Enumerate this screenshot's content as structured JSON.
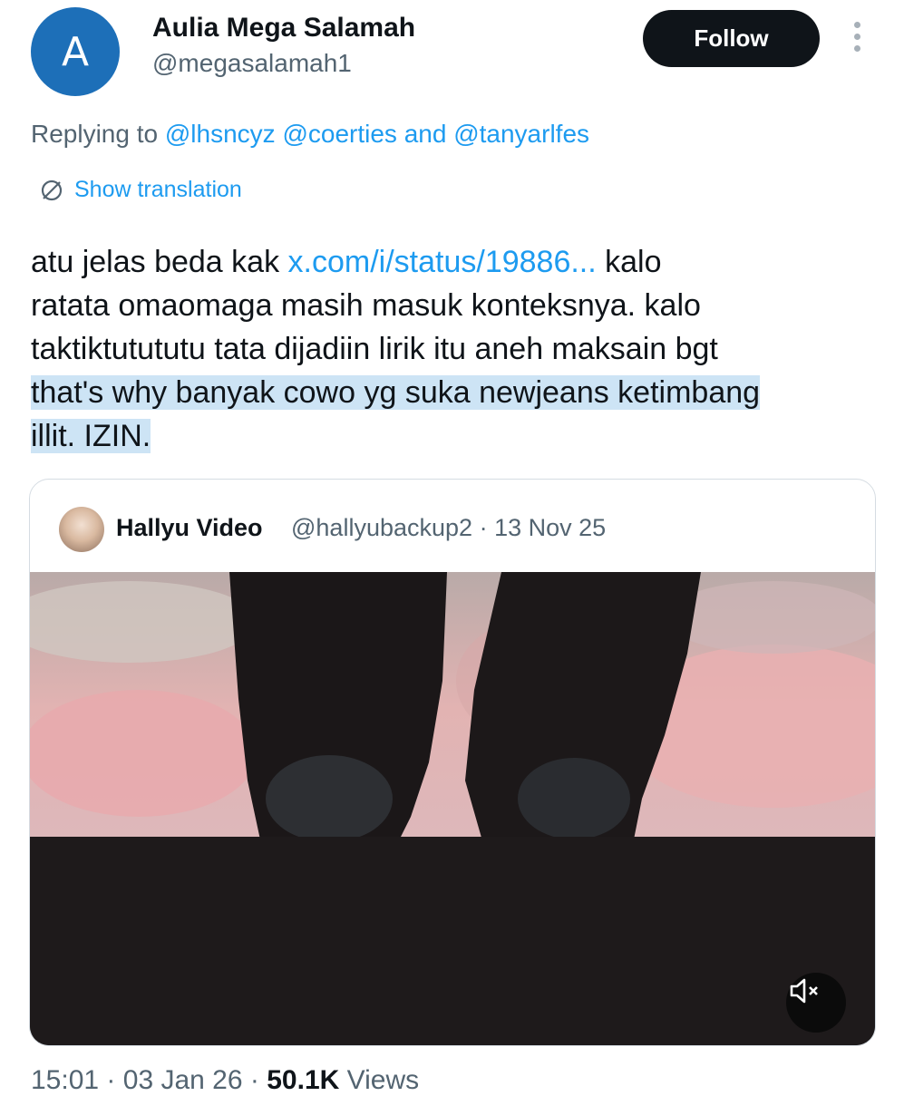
{
  "author": {
    "initial": "A",
    "display_name": "Aulia Mega Salamah",
    "handle": "@megasalamah1",
    "avatar_color": "#1d6fb8"
  },
  "follow_label": "Follow",
  "replying": {
    "prefix": "Replying to",
    "mention_1": "@lhsncyz",
    "mention_2": "@coerties",
    "conjunction": "and",
    "mention_3": "@tanyarlfes"
  },
  "show_translation": "Show translation",
  "tweet": {
    "line1_pre": "atu jelas beda kak ",
    "link": "x.com/i/status/19886...",
    "line1_post": " kalo",
    "line2": "ratata omaomaga masih masuk konteksnya. kalo",
    "line3": "taktiktutututu tata dijadiin lirik itu aneh maksain bgt",
    "line4": "that's why banyak cowo yg suka newjeans ketimbang",
    "line5": "illit. IZIN."
  },
  "quote": {
    "name": "Hallyu Video",
    "handle": "@hallyubackup2",
    "separator": "·",
    "date": "13 Nov 25"
  },
  "footer": {
    "time": "15:01",
    "sep1": "·",
    "date": "03 Jan 26",
    "sep2": "·",
    "views_count": "50.1K",
    "views_label": "Views"
  },
  "colors": {
    "link": "#1d9bf0",
    "secondary_text": "#536471",
    "highlight": "#cde4f5",
    "button_bg": "#0f1419"
  },
  "icons": {
    "more": "more-vertical-icon",
    "translate": "translate-globe-icon",
    "mute": "volume-muted-icon"
  }
}
